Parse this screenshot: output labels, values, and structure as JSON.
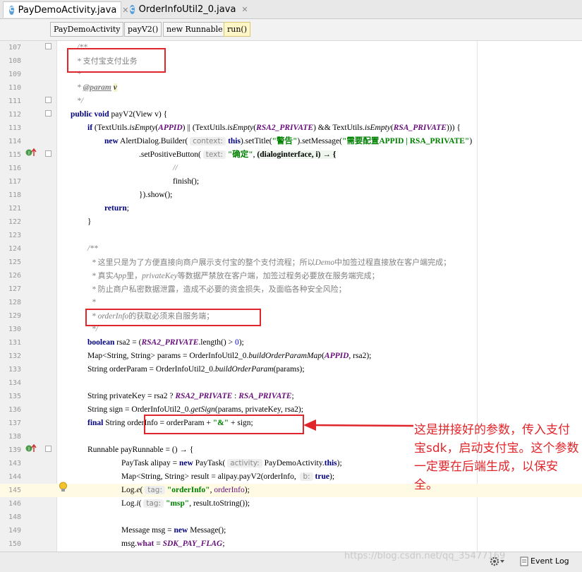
{
  "tabs": [
    {
      "label": "PayDemoActivity.java",
      "active": true
    },
    {
      "label": "OrderInfoUtil2_0.java",
      "active": false
    }
  ],
  "breadcrumbs": [
    "PayDemoActivity",
    "payV2()",
    "new Runnable",
    "run()"
  ],
  "lines": [
    {
      "n": "107",
      "html": "<span class=\"cm\">/**</span>"
    },
    {
      "n": "108",
      "html": "<span class=\"cm\">* </span><span class=\"dc\">支付宝支付业务</span>"
    },
    {
      "n": "109",
      "html": "<span class=\"cm\">*</span>"
    },
    {
      "n": "110",
      "html": "<span class=\"cm\">* <b><u>@param</u></b> <b style=\"color:#3d3d3d;background:#f3f3c8\">v</b></span>"
    },
    {
      "n": "111",
      "html": "<span class=\"cm\">*/</span>"
    },
    {
      "n": "112",
      "html": "<span class=\"kw\">public void</span> payV2(View v) {"
    },
    {
      "n": "113",
      "html": "<span class=\"kw\">if</span> (TextUtils.<span class=\"it\">isEmpty</span>(<span class=\"cst\">APPID</span>) || (TextUtils.<span class=\"it\">isEmpty</span>(<span class=\"cst\">RSA2_PRIVATE</span>) &amp;&amp; TextUtils.<span class=\"it\">isEmpty</span>(<span class=\"cst\">RSA_PRIVATE</span>))) {"
    },
    {
      "n": "114",
      "html": "<span class=\"kw\">new</span> AlertDialog.Builder( <span class=\"hint\">context:</span> <span class=\"kw\">this</span>).setTitle(<span class=\"str\">\"警告\"</span>).setMessage(<span class=\"str\">\"需要配置APPID | RSA_PRIVATE\"</span>)"
    },
    {
      "n": "115",
      "html": ".setPositiveButton( <span class=\"hint\">text:</span> <span class=\"str\">\"确定\"</span>, <span style=\"background:#eef6ee;font-weight:bold\">(dialoginterface, i) → {</span>"
    },
    {
      "n": "116",
      "html": "<span class=\"cm\">//</span>"
    },
    {
      "n": "117",
      "html": "finish();"
    },
    {
      "n": "118",
      "html": "}).show();"
    },
    {
      "n": "121",
      "html": "<span class=\"kw\">return</span>;"
    },
    {
      "n": "122",
      "html": "}"
    },
    {
      "n": "123",
      "html": ""
    },
    {
      "n": "124",
      "html": "<span class=\"cm\">/**</span>"
    },
    {
      "n": "125",
      "html": "<span class=\"cm\">* </span><span class=\"dc\">这里只是为了方便直接向商户展示支付宝的整个支付流程；所以</span><span class=\"cm\">Demo</span><span class=\"dc\">中加签过程直接放在客户端完成；</span>"
    },
    {
      "n": "126",
      "html": "<span class=\"cm\">* </span><span class=\"dc\">真实</span><span class=\"cm\">App</span><span class=\"dc\">里，</span><span class=\"cm\">privateKey</span><span class=\"dc\">等数据严禁放在客户端，加签过程务必要放在服务端完成；</span>"
    },
    {
      "n": "127",
      "html": "<span class=\"cm\">* </span><span class=\"dc\">防止商户私密数据泄露，造成不必要的资金损失，及面临各种安全风险；</span>"
    },
    {
      "n": "128",
      "html": "<span class=\"cm\">*</span>"
    },
    {
      "n": "129",
      "html": "<span class=\"cm\">* orderInfo</span><span class=\"dc\">的获取必须来自服务端；</span>"
    },
    {
      "n": "130",
      "html": "<span class=\"cm\">*/</span>"
    },
    {
      "n": "131",
      "html": "<span class=\"kw\">boolean</span> rsa2 = (<span class=\"cst\">RSA2_PRIVATE</span>.length() &gt; <span style=\"color:#0000ff\">0</span>);"
    },
    {
      "n": "132",
      "html": "Map&lt;String, String&gt; params = OrderInfoUtil2_0.<span class=\"it\">buildOrderParamMap</span>(<span class=\"cst\">APPID</span>, rsa2);"
    },
    {
      "n": "133",
      "html": "String orderParam = OrderInfoUtil2_0.<span class=\"it\">buildOrderParam</span>(params);"
    },
    {
      "n": "134",
      "html": ""
    },
    {
      "n": "135",
      "html": "String privateKey = rsa2 ? <span class=\"cst\">RSA2_PRIVATE</span> : <span class=\"cst\">RSA_PRIVATE</span>;"
    },
    {
      "n": "136",
      "html": "String sign = OrderInfoUtil2_0.<span class=\"it\">getSign</span>(params, privateKey, rsa2);"
    },
    {
      "n": "137",
      "html": "<span class=\"kw\">final</span> String orderInfo = orderParam + <span class=\"str\">\"&amp;\"</span> + sign;"
    },
    {
      "n": "138",
      "html": ""
    },
    {
      "n": "139",
      "html": "Runnable payRunnable = () → {"
    },
    {
      "n": "143",
      "html": "PayTask alipay = <span class=\"kw\">new</span> PayTask( <span class=\"hint\">activity:</span> PayDemoActivity.<span class=\"kw\">this</span>);"
    },
    {
      "n": "144",
      "html": "Map&lt;String, String&gt; result = alipay.payV2(orderInfo,  <span class=\"hint\">b:</span> <span class=\"kw\">true</span>);"
    },
    {
      "n": "145",
      "html": "Log.<span class=\"it\">e</span>( <span class=\"hint\">tag:</span> <span class=\"str\">\"orderInfo\"</span>, <span style=\"color:#660e7a\">orderInfo</span>);"
    },
    {
      "n": "146",
      "html": "Log.<span class=\"it\">i</span>( <span class=\"hint\">tag:</span> <span class=\"str\">\"msp\"</span>, result.toString());"
    },
    {
      "n": "148",
      "html": ""
    },
    {
      "n": "149",
      "html": "Message msg = <span class=\"kw\">new</span> Message();"
    },
    {
      "n": "150",
      "html": "msg.<span style=\"color:#660e7a;font-weight:bold\">what</span> = <span class=\"cst\">SDK_PAY_FLAG</span>;"
    }
  ],
  "annotation": "这是拼接好的参数，传入支付宝sdk，启动支付宝。这个参数一定要在后端生成，以保安全。",
  "watermark": "https://blog.csdn.net/qq_35477169",
  "status": {
    "event_log": "Event Log"
  }
}
